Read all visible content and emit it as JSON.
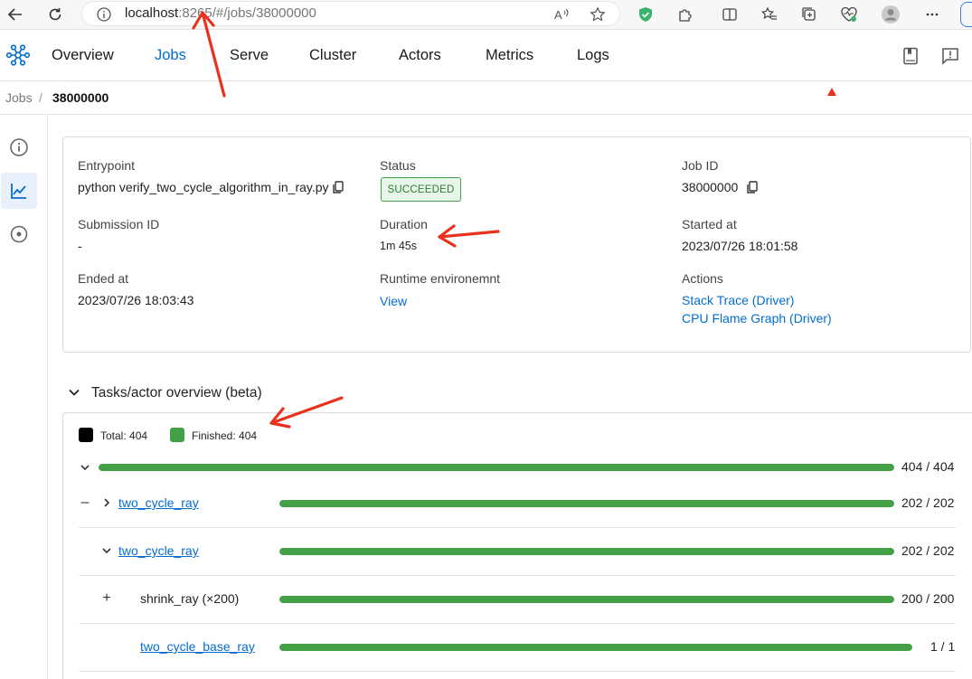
{
  "browser": {
    "url_host": "localhost",
    "url_path": ":8265/#/jobs/38000000",
    "icons": [
      "back-arrow-icon",
      "reload-icon",
      "site-info-icon",
      "read-aloud-icon",
      "favorite-star-icon",
      "shield-icon",
      "extensions-icon",
      "split-screen-icon",
      "favorites-icon",
      "collections-icon",
      "browser-health-icon",
      "profile-icon",
      "more-icon"
    ]
  },
  "header": {
    "tabs": [
      {
        "label": "Overview",
        "active": false
      },
      {
        "label": "Jobs",
        "active": true
      },
      {
        "label": "Serve",
        "active": false
      },
      {
        "label": "Cluster",
        "active": false
      },
      {
        "label": "Actors",
        "active": false
      },
      {
        "label": "Metrics",
        "active": false
      },
      {
        "label": "Logs",
        "active": false
      }
    ],
    "icons": [
      "ray-logo-icon",
      "docs-book-icon",
      "feedback-icon"
    ]
  },
  "breadcrumb": {
    "parent": "Jobs",
    "separator": "/",
    "current": "38000000"
  },
  "side_rail": {
    "items": [
      {
        "icon": "info-icon",
        "active": false
      },
      {
        "icon": "chart-line-icon",
        "active": true
      },
      {
        "icon": "target-icon",
        "active": false
      }
    ]
  },
  "job_info": {
    "entrypoint_label": "Entrypoint",
    "entrypoint_value": "python verify_two_cycle_algorithm_in_ray.py",
    "status_label": "Status",
    "status_value": "SUCCEEDED",
    "job_id_label": "Job ID",
    "job_id_value": "38000000",
    "submission_id_label": "Submission ID",
    "submission_id_value": "-",
    "duration_label": "Duration",
    "duration_value": "1m 45s",
    "started_at_label": "Started at",
    "started_at_value": "2023/07/26 18:01:58",
    "ended_at_label": "Ended at",
    "ended_at_value": "2023/07/26 18:03:43",
    "runtime_env_label": "Runtime environemnt",
    "runtime_env_link": "View",
    "actions_label": "Actions",
    "action_stack_trace": "Stack Trace (Driver)",
    "action_flame_graph": "CPU Flame Graph (Driver)"
  },
  "overview": {
    "title": "Tasks/actor overview (beta)",
    "legend": [
      {
        "label": "Total: 404",
        "color": "#000000"
      },
      {
        "label": "Finished: 404",
        "color": "#43a047"
      }
    ],
    "bar_color": "#43a047",
    "rows": [
      {
        "name": "",
        "count": "404 / 404",
        "fraction": 1.0
      },
      {
        "name": "two_cycle_ray",
        "prefix": "–",
        "expander": "›",
        "count": "202 / 202",
        "fraction": 1.0
      },
      {
        "name": "two_cycle_ray",
        "expander": "⌄",
        "count": "202 / 202",
        "fraction": 1.0
      },
      {
        "name": "shrink_ray (×200)",
        "prefix": "+",
        "count": "200 / 200",
        "fraction": 1.0
      },
      {
        "name": "two_cycle_base_ray",
        "count": "1 / 1",
        "fraction": 1.0
      }
    ]
  },
  "annotations": {
    "color": "#e8321e"
  }
}
